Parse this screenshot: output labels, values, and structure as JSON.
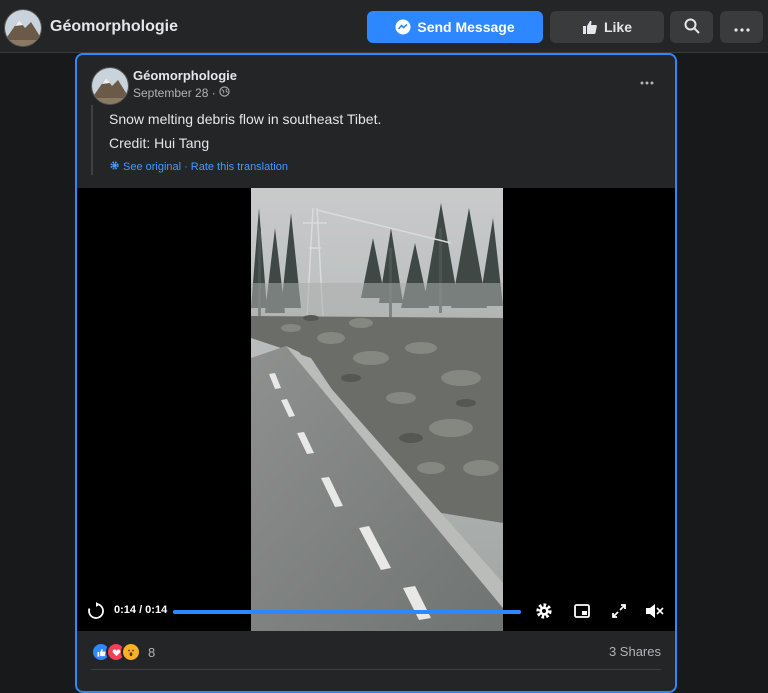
{
  "header": {
    "page_name": "Géomorphologie",
    "send_message_label": "Send Message",
    "like_label": "Like"
  },
  "post": {
    "author": "Géomorphologie",
    "date": "September 28 ·",
    "text_line1": "Snow melting debris flow in southeast Tibet.",
    "text_line2": "Credit: Hui Tang",
    "see_original": "See original",
    "separator": "·",
    "rate_translation": "Rate this translation"
  },
  "video": {
    "time": "0:14 / 0:14",
    "progress": 1.0
  },
  "footer": {
    "reaction_count": "8",
    "shares": "3 Shares"
  },
  "colors": {
    "accent": "#2d88ff",
    "background": "#18191a",
    "card": "#242526"
  }
}
